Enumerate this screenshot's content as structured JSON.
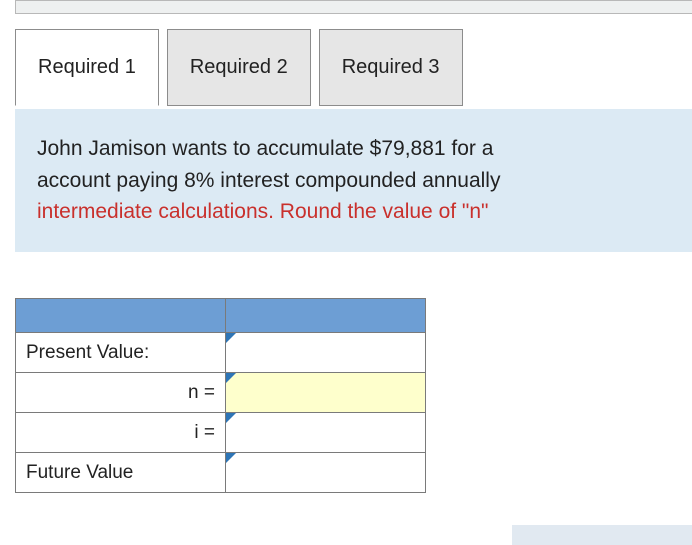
{
  "tabs": {
    "t1": "Required 1",
    "t2": "Required 2",
    "t3": "Required 3"
  },
  "prompt": {
    "line1": "John Jamison wants to accumulate $79,881 for a ",
    "line2": "account paying 8% interest compounded annually",
    "line3": "intermediate calculations. Round the value of \"n\" "
  },
  "table": {
    "present_value_label": "Present Value:",
    "n_label": "n =",
    "i_label": "i =",
    "future_value_label": "Future Value",
    "present_value": "",
    "n_value": "",
    "i_value": "",
    "future_value": ""
  }
}
